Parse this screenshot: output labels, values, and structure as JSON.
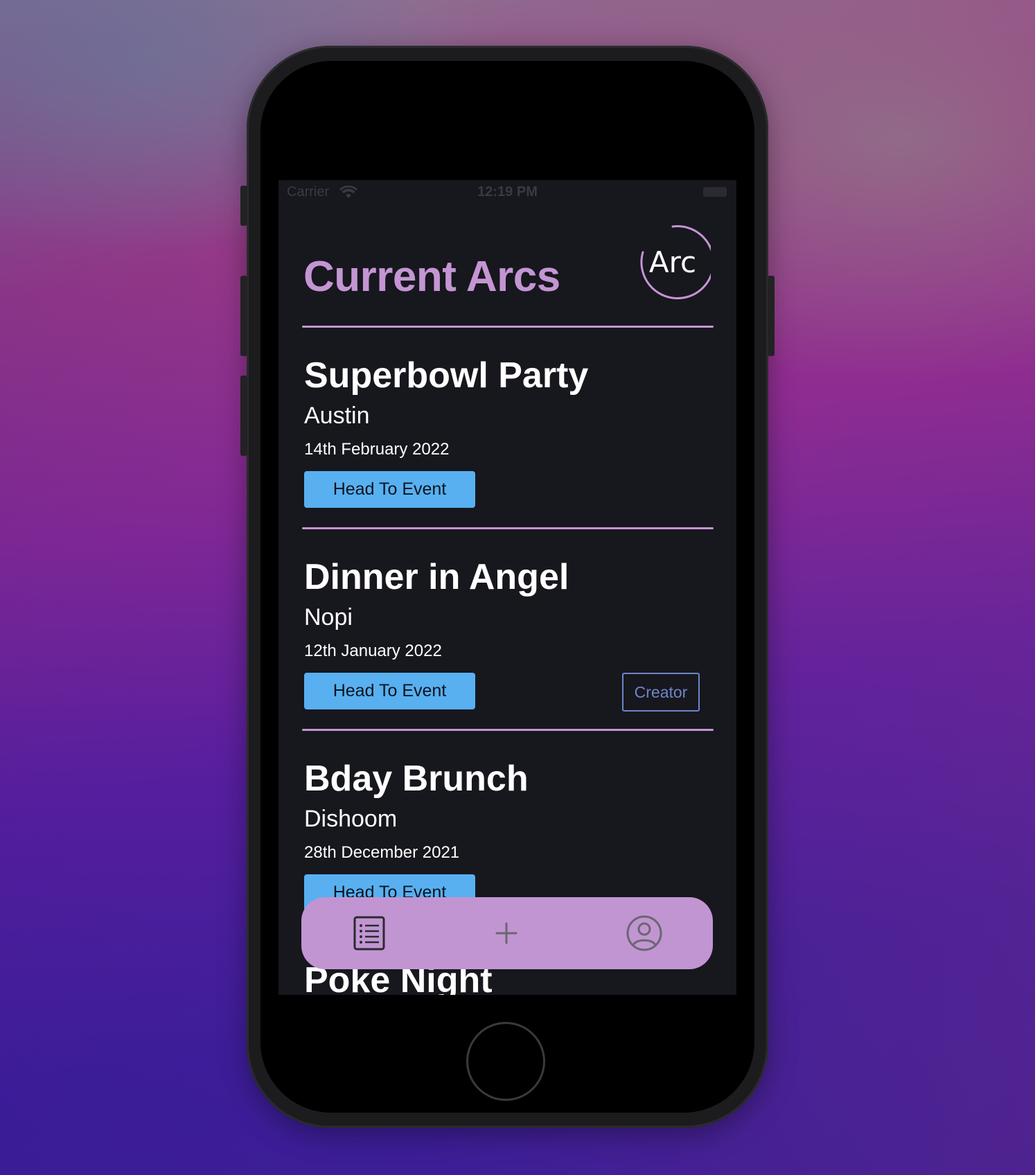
{
  "status_bar": {
    "carrier": "Carrier",
    "time": "12:19 PM"
  },
  "header": {
    "title": "Current Arcs",
    "logo_text": "Arc"
  },
  "events": [
    {
      "title": "Superbowl Party",
      "venue": "Austin",
      "date": "14th February 2022",
      "button_label": "Head To Event"
    },
    {
      "title": "Dinner in Angel",
      "venue": "Nopi",
      "date": "12th January 2022",
      "button_label": "Head To Event",
      "badge": "Creator"
    },
    {
      "title": "Bday Brunch",
      "venue": "Dishoom",
      "date": "28th December 2021",
      "button_label": "Head To Event"
    },
    {
      "title": "Poke Night"
    }
  ],
  "tab_bar": {
    "items": [
      {
        "icon": "list-icon"
      },
      {
        "icon": "plus-icon"
      },
      {
        "icon": "profile-icon"
      }
    ]
  },
  "colors": {
    "accent": "#c495d3",
    "button_blue": "#58b0f0",
    "creator_outline": "#6e86c8",
    "screen_bg": "#17171e",
    "tab_bar_bg": "#c195d2"
  }
}
